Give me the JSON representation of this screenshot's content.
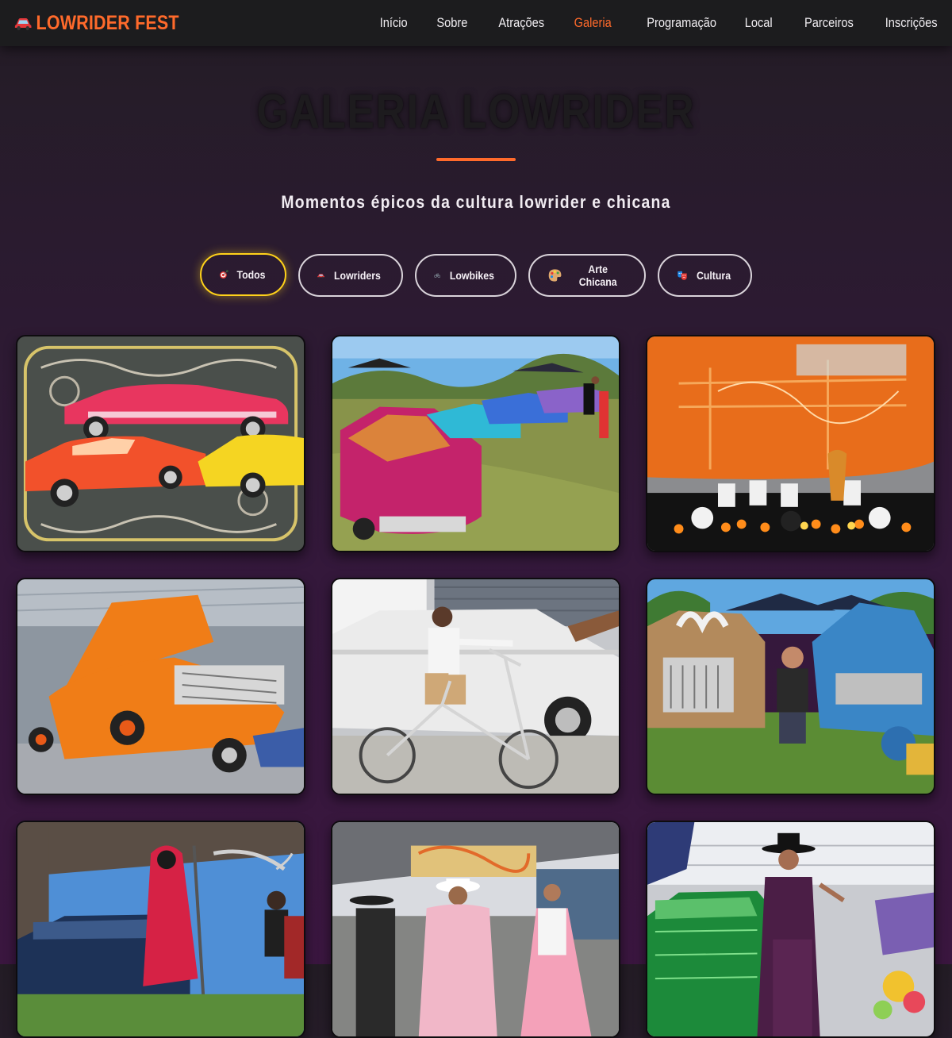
{
  "brand": {
    "name": "LOWRIDER FEST",
    "icon": "car-icon"
  },
  "nav": {
    "items": [
      {
        "label": "Início"
      },
      {
        "label": "Sobre"
      },
      {
        "label": "Atrações"
      },
      {
        "label": "Galeria",
        "active": true
      },
      {
        "label": "Programação"
      },
      {
        "label": "Local"
      },
      {
        "label": "Parceiros"
      },
      {
        "label": "Inscrições"
      }
    ]
  },
  "hero": {
    "title": "GALERIA LOWRIDER",
    "subtitle": "Momentos épicos da cultura lowrider e chicana"
  },
  "filters": [
    {
      "label": "Todos",
      "icon": "target-icon",
      "active": true
    },
    {
      "label": "Lowriders",
      "icon": "car-icon"
    },
    {
      "label": "Lowbikes",
      "icon": "bicycle-icon"
    },
    {
      "label": "Arte Chicana",
      "icon": "palette-icon"
    },
    {
      "label": "Cultura",
      "icon": "theater-masks-icon"
    }
  ],
  "colors": {
    "accent": "#ff6a2b",
    "active_filter_border": "#ffd21a",
    "navbar_bg": "#1c1c1e"
  }
}
